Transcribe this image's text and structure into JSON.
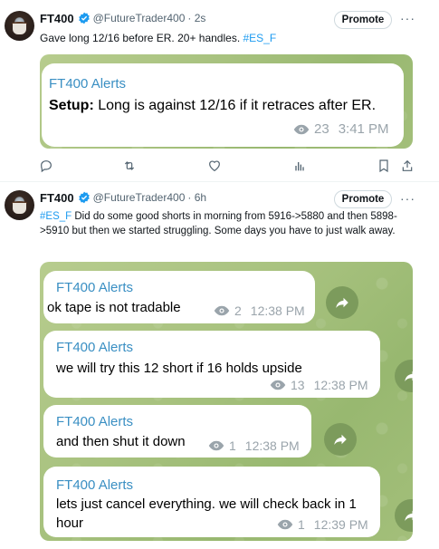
{
  "tweet1": {
    "name": "FT400",
    "handle": "@FutureTrader400",
    "time": "· 2s",
    "promote_label": "Promote",
    "text_plain": "Gave long 12/16 before ER.  20+ handles. ",
    "hashtag": "#ES_F",
    "message": {
      "sender": "FT400 Alerts",
      "setup_label": "Setup:",
      "setup_text": "  Long is against  12/16 if it retraces after ER.",
      "views": "23",
      "time": "3:41 PM"
    }
  },
  "tweet2": {
    "name": "FT400",
    "handle": "@FutureTrader400",
    "time": "· 6h",
    "promote_label": "Promote",
    "hashtag": "#ES_F",
    "text_plain": " Did do some good shorts in morning from 5916->5880 and then 5898->5910 but then we started struggling. Some days you have to just walk away.",
    "messages": [
      {
        "sender": "FT400 Alerts",
        "text": "ok tape is not tradable",
        "views": "2",
        "time": "12:38 PM"
      },
      {
        "sender": "FT400 Alerts",
        "text": "we will try this 12 short if 16 holds upside",
        "views": "13",
        "time": "12:38 PM"
      },
      {
        "sender": "FT400 Alerts",
        "text": "and then shut it down",
        "views": "1",
        "time": "12:38 PM"
      },
      {
        "sender": "FT400 Alerts",
        "text": "lets just cancel everything. we will check back in 1 hour",
        "views": "1",
        "time": "12:39 PM"
      }
    ]
  },
  "icons": [
    "verified-badge-icon",
    "more-icon",
    "eye-icon",
    "share-arrow-icon",
    "reply-icon",
    "retweet-icon",
    "like-icon",
    "views-icon",
    "bookmark-icon",
    "share-icon"
  ],
  "colors": {
    "link": "#1d9bf0",
    "telegram_sender": "#3a8fc3",
    "muted": "#536471",
    "telegram_bg": "#a8c27f"
  }
}
